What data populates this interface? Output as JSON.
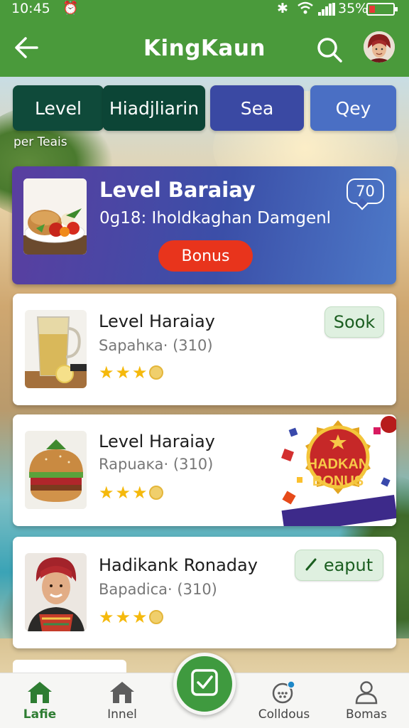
{
  "status_bar": {
    "time": "10:45",
    "battery_pct": "35%"
  },
  "app_bar": {
    "title": "KingKaun"
  },
  "tabs": [
    {
      "label": "Level"
    },
    {
      "label": "Hiadjliarin"
    },
    {
      "label": "Sea"
    },
    {
      "label": "Qey"
    }
  ],
  "section_caption": "per Teais",
  "featured": {
    "title": "Level Baraiay",
    "subtitle": "0ɡ18: Iholdkaghan Damgenl",
    "button_label": "Bonus",
    "count": "70"
  },
  "items": [
    {
      "title": "Level Haraiay",
      "subtitle": "Sapahĸa· (310)",
      "action_label": "Sook",
      "rating": 3.5
    },
    {
      "title": "Level Haraiay",
      "subtitle": "Rapuaĸa· (310)",
      "rating": 3.5,
      "badge_text_1": "HADKAN",
      "badge_text_2": "BONUS"
    },
    {
      "title": "Hadikank Ronaday",
      "subtitle": "Bapadica· (310)",
      "action_label": "eaput",
      "rating": 3.5
    }
  ],
  "bottom_nav": [
    {
      "label": "Lafie"
    },
    {
      "label": "Innel"
    },
    {
      "label": "Colldous"
    },
    {
      "label": "Bomas"
    }
  ],
  "colors": {
    "app_bar": "#4a9a3b",
    "accent_red": "#e8341c",
    "star": "#f5b90c"
  }
}
